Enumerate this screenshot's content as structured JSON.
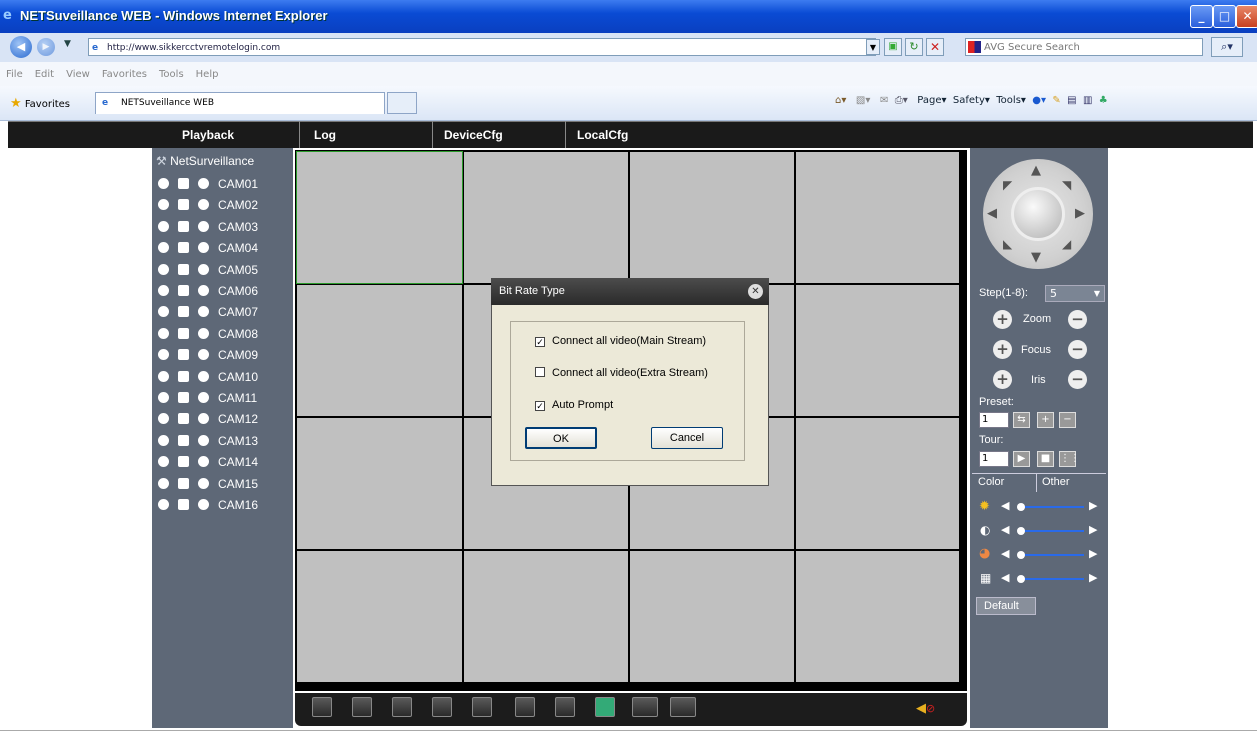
{
  "window": {
    "title": "NETSuveillance WEB - Windows Internet Explorer"
  },
  "browser": {
    "url": "http://www.sikkercctvremotelogin.com",
    "search_placeholder": "AVG Secure Search",
    "menu": [
      "File",
      "Edit",
      "View",
      "Favorites",
      "Tools",
      "Help"
    ],
    "favorites_label": "Favorites",
    "tab_title": "NETSuveillance WEB",
    "cmd": {
      "page": "Page",
      "safety": "Safety",
      "tools": "Tools"
    }
  },
  "app_nav": [
    "Playback",
    "Log",
    "DeviceCfg",
    "LocalCfg"
  ],
  "device_tree": {
    "root": "NetSurveillance",
    "cameras": [
      "CAM01",
      "CAM02",
      "CAM03",
      "CAM04",
      "CAM05",
      "CAM06",
      "CAM07",
      "CAM08",
      "CAM09",
      "CAM10",
      "CAM11",
      "CAM12",
      "CAM13",
      "CAM14",
      "CAM15",
      "CAM16"
    ]
  },
  "ptz": {
    "step_label": "Step(1-8):",
    "step_value": "5",
    "zoom": "Zoom",
    "focus": "Focus",
    "iris": "Iris",
    "preset_label": "Preset:",
    "preset_value": "1",
    "tour_label": "Tour:",
    "tour_value": "1"
  },
  "image_tabs": {
    "color": "Color",
    "other": "Other",
    "default_button": "Default"
  },
  "image_sliders": [
    0.05,
    0.05,
    0.05,
    0.05
  ],
  "dialog": {
    "title": "Bit Rate Type",
    "options": [
      {
        "label": "Connect all video(Main Stream)",
        "checked": true
      },
      {
        "label": "Connect all video(Extra Stream)",
        "checked": false
      },
      {
        "label": "Auto Prompt",
        "checked": true
      }
    ],
    "ok": "OK",
    "cancel": "Cancel"
  }
}
